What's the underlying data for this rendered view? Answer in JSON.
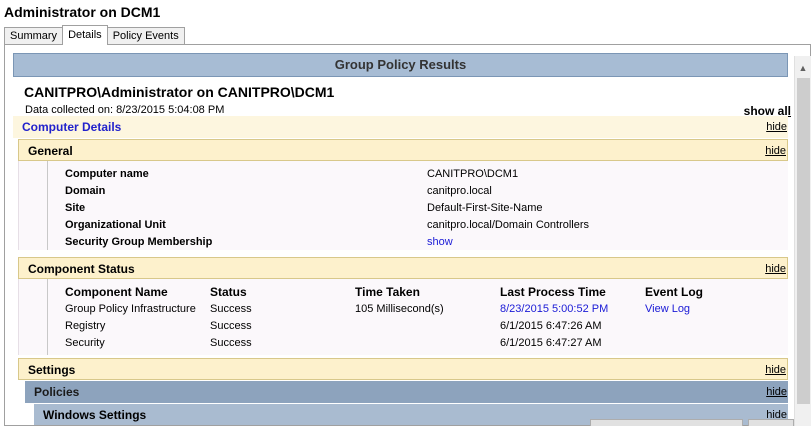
{
  "window": {
    "title": "Administrator on DCM1"
  },
  "tabs": [
    {
      "label": "Summary",
      "active": false
    },
    {
      "label": "Details",
      "active": true
    },
    {
      "label": "Policy Events",
      "active": false
    }
  ],
  "report": {
    "header": "Group Policy Results",
    "title": "CANITPRO\\Administrator on CANITPRO\\DCM1",
    "collected": "Data collected on: 8/23/2015 5:04:08 PM",
    "show_all": "show all",
    "hide": "hide",
    "computer_details": "Computer Details",
    "general": {
      "label": "General",
      "rows": [
        {
          "label": "Computer name",
          "value": "CANITPRO\\DCM1"
        },
        {
          "label": "Domain",
          "value": "canitpro.local"
        },
        {
          "label": "Site",
          "value": "Default-First-Site-Name"
        },
        {
          "label": "Organizational Unit",
          "value": "canitpro.local/Domain Controllers"
        },
        {
          "label": "Security Group Membership",
          "value": "show"
        }
      ]
    },
    "component_status": {
      "label": "Component Status",
      "columns": [
        "Component Name",
        "Status",
        "Time Taken",
        "Last Process Time",
        "Event Log"
      ],
      "rows": [
        [
          "Group Policy Infrastructure",
          "Success",
          "105 Millisecond(s)",
          "8/23/2015 5:00:52 PM",
          "View Log"
        ],
        [
          "Registry",
          "Success",
          "",
          "6/1/2015 6:47:26 AM",
          ""
        ],
        [
          "Security",
          "Success",
          "",
          "6/1/2015 6:47:27 AM",
          ""
        ]
      ]
    },
    "settings": {
      "label": "Settings"
    },
    "policies": {
      "label": "Policies"
    },
    "windows_settings": {
      "label": "Windows Settings"
    }
  },
  "colors": {
    "header_bg": "#a7bcd4",
    "section_bg": "#fdf1cc",
    "link": "#1a1ad6",
    "policies_bg": "#8da3bd"
  }
}
